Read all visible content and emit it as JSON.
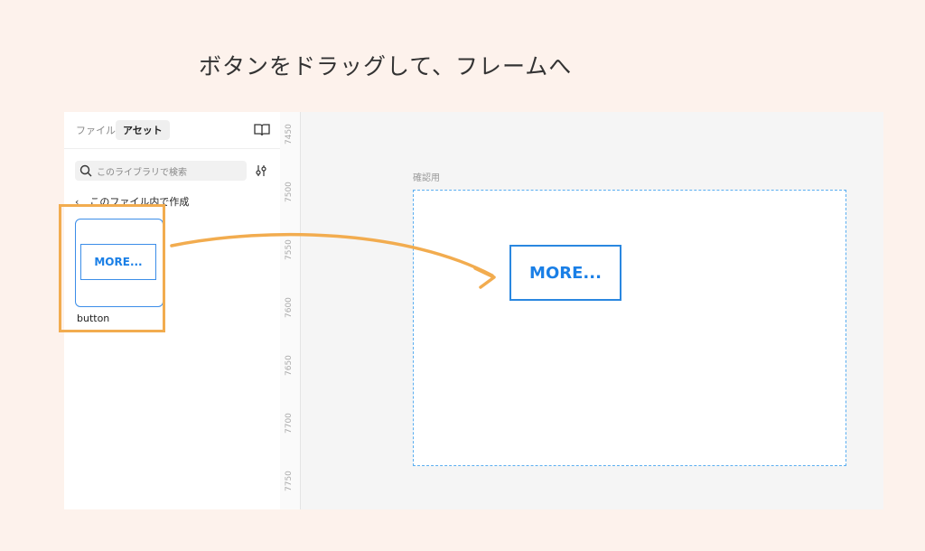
{
  "headline": "ボタンをドラッグして、フレームへ",
  "panel": {
    "tabs": {
      "files": "ファイル",
      "assets": "アセット"
    },
    "search_placeholder": "このライブラリで検索",
    "back_label": "このファイル内で作成",
    "component": {
      "preview_text": "MORE...",
      "name": "button"
    }
  },
  "ruler": {
    "ticks": [
      "7450",
      "7500",
      "7550",
      "7600",
      "7650",
      "7700",
      "7750"
    ]
  },
  "canvas": {
    "frame_label": "確認用",
    "placed_button": "MORE..."
  },
  "colors": {
    "accent": "#f2ac4f",
    "selection": "#2a87e0"
  }
}
